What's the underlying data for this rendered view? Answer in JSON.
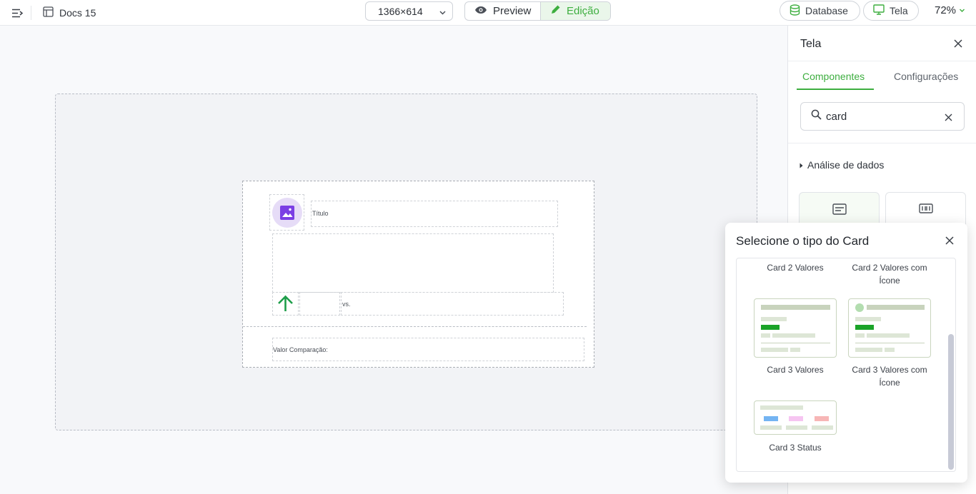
{
  "topbar": {
    "doc_title": "Docs 15",
    "size_label": "1366×614",
    "mode_preview": "Preview",
    "mode_edit": "Edição",
    "database_label": "Database",
    "tela_label": "Tela",
    "zoom": "72%"
  },
  "canvas": {
    "card_title": "Título",
    "vs_label": "vs.",
    "comparison_label": "Valor Comparação:"
  },
  "panel": {
    "title": "Tela",
    "tabs": [
      "Componentes",
      "Configurações"
    ],
    "search_value": "card",
    "section_label": "Análise de dados"
  },
  "popup": {
    "title": "Selecione o tipo do Card",
    "options": [
      "Card 2 Valores",
      "Card 2 Valores com Ícone",
      "Card 3 Valores",
      "Card 3 Valores com Ícone",
      "Card 3 Status"
    ]
  },
  "colors": {
    "accent": "#3dae3f",
    "arrow_up": "#1e9e4a",
    "image_placeholder": "#7b3fe4"
  },
  "icons": [
    "sidebar-toggle-icon",
    "document-icon",
    "chevron-down-icon",
    "eye-icon",
    "pencil-icon",
    "database-icon",
    "monitor-icon",
    "close-icon",
    "search-icon",
    "image-icon",
    "arrow-up-icon"
  ]
}
